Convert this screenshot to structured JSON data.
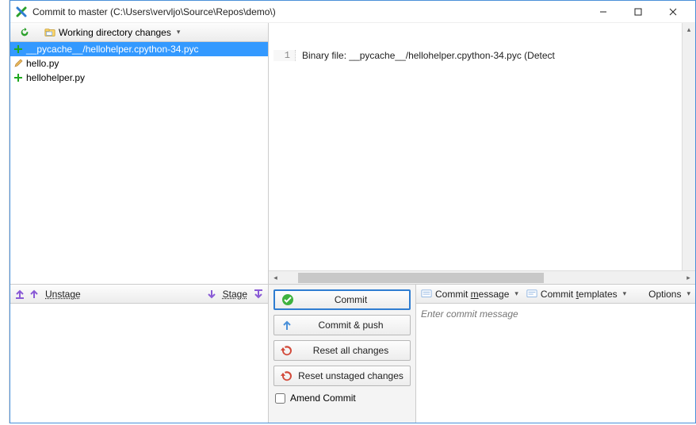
{
  "window": {
    "title": "Commit to master (C:\\Users\\vervljo\\Source\\Repos\\demo\\)"
  },
  "toolbar": {
    "working_label": "Working directory changes"
  },
  "files": [
    {
      "status": "add",
      "name": "__pycache__/hellohelper.cpython-34.pyc",
      "selected": true
    },
    {
      "status": "edit",
      "name": "hello.py",
      "selected": false
    },
    {
      "status": "add",
      "name": "hellohelper.py",
      "selected": false
    }
  ],
  "diff": {
    "line_no": "1",
    "content": "Binary file: __pycache__/hellohelper.cpython-34.pyc (Detect"
  },
  "stage": {
    "unstage_label": "Unstage",
    "stage_label": "Stage"
  },
  "actions": {
    "commit": "Commit",
    "commit_push": "Commit & push",
    "reset_all": "Reset all changes",
    "reset_unstaged": "Reset unstaged changes",
    "amend": "Amend Commit"
  },
  "msgbar": {
    "commit_message": "Commit message",
    "commit_templates": "Commit templates",
    "options": "Options"
  },
  "commit_msg": {
    "placeholder": "Enter commit message"
  }
}
